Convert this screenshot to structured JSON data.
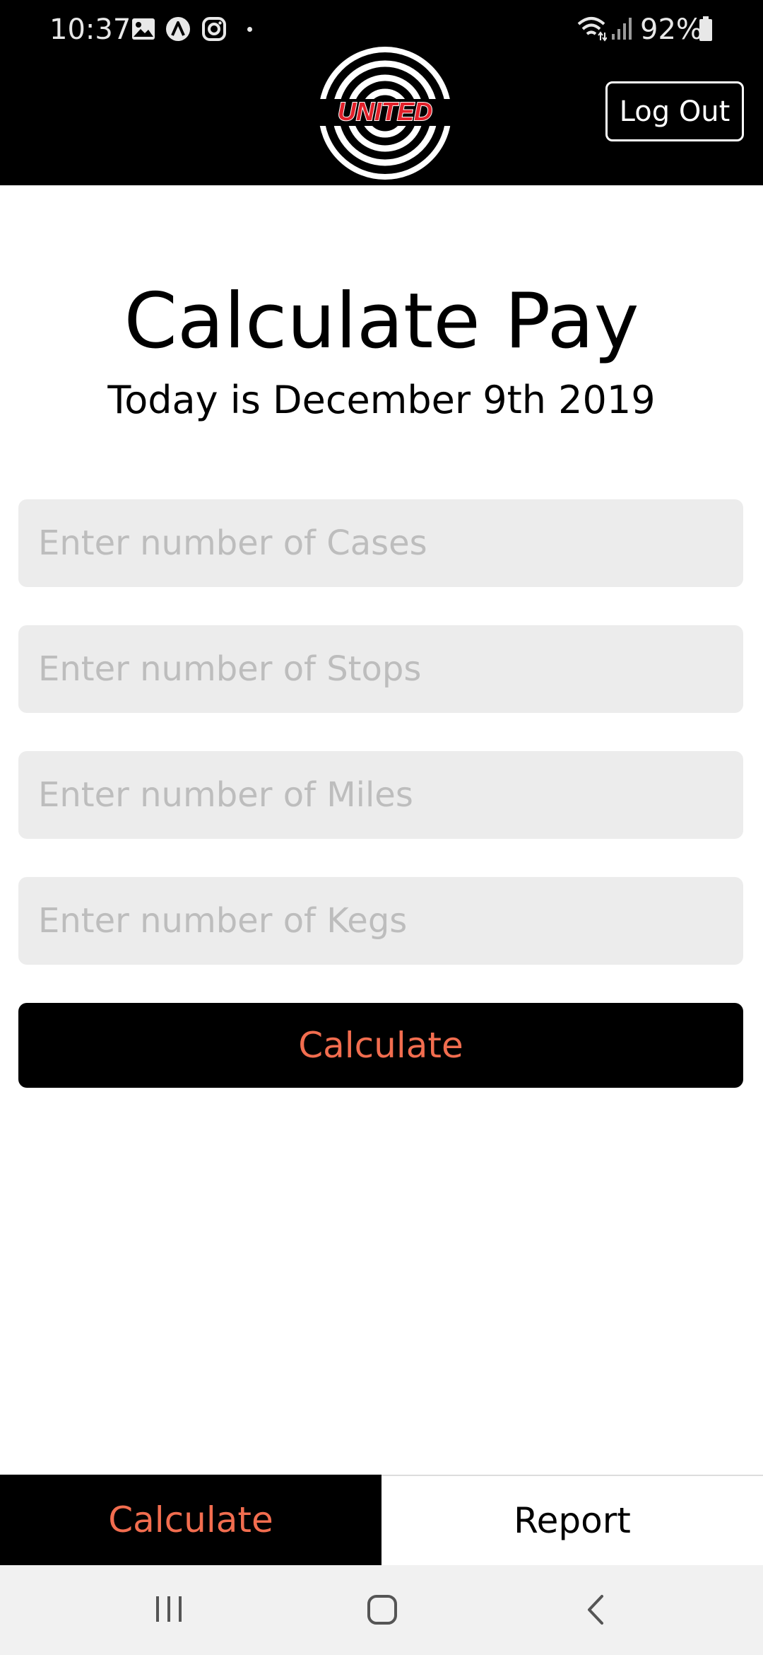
{
  "status_bar": {
    "time": "10:37",
    "battery": "92%"
  },
  "header": {
    "logo_text": "UNITED",
    "logout_label": "Log Out"
  },
  "main": {
    "title": "Calculate Pay",
    "subtitle": "Today is December 9th 2019",
    "fields": {
      "cases": {
        "placeholder": "Enter number of Cases",
        "value": ""
      },
      "stops": {
        "placeholder": "Enter number of Stops",
        "value": ""
      },
      "miles": {
        "placeholder": "Enter number of Miles",
        "value": ""
      },
      "kegs": {
        "placeholder": "Enter number of Kegs",
        "value": ""
      }
    },
    "calculate_label": "Calculate"
  },
  "tabs": {
    "calculate_label": "Calculate",
    "report_label": "Report",
    "active": "calculate"
  },
  "colors": {
    "accent": "#f26d4f",
    "header_bg": "#000000",
    "field_bg": "#ececec",
    "logo_red": "#e3202a"
  },
  "icons": {
    "status_left": [
      "image-icon",
      "app-a-icon",
      "instagram-icon",
      "notification-dot-icon"
    ],
    "status_right": [
      "wifi-icon",
      "signal-icon",
      "battery-icon"
    ],
    "nav": [
      "recent-apps-icon",
      "home-icon",
      "back-icon"
    ]
  }
}
